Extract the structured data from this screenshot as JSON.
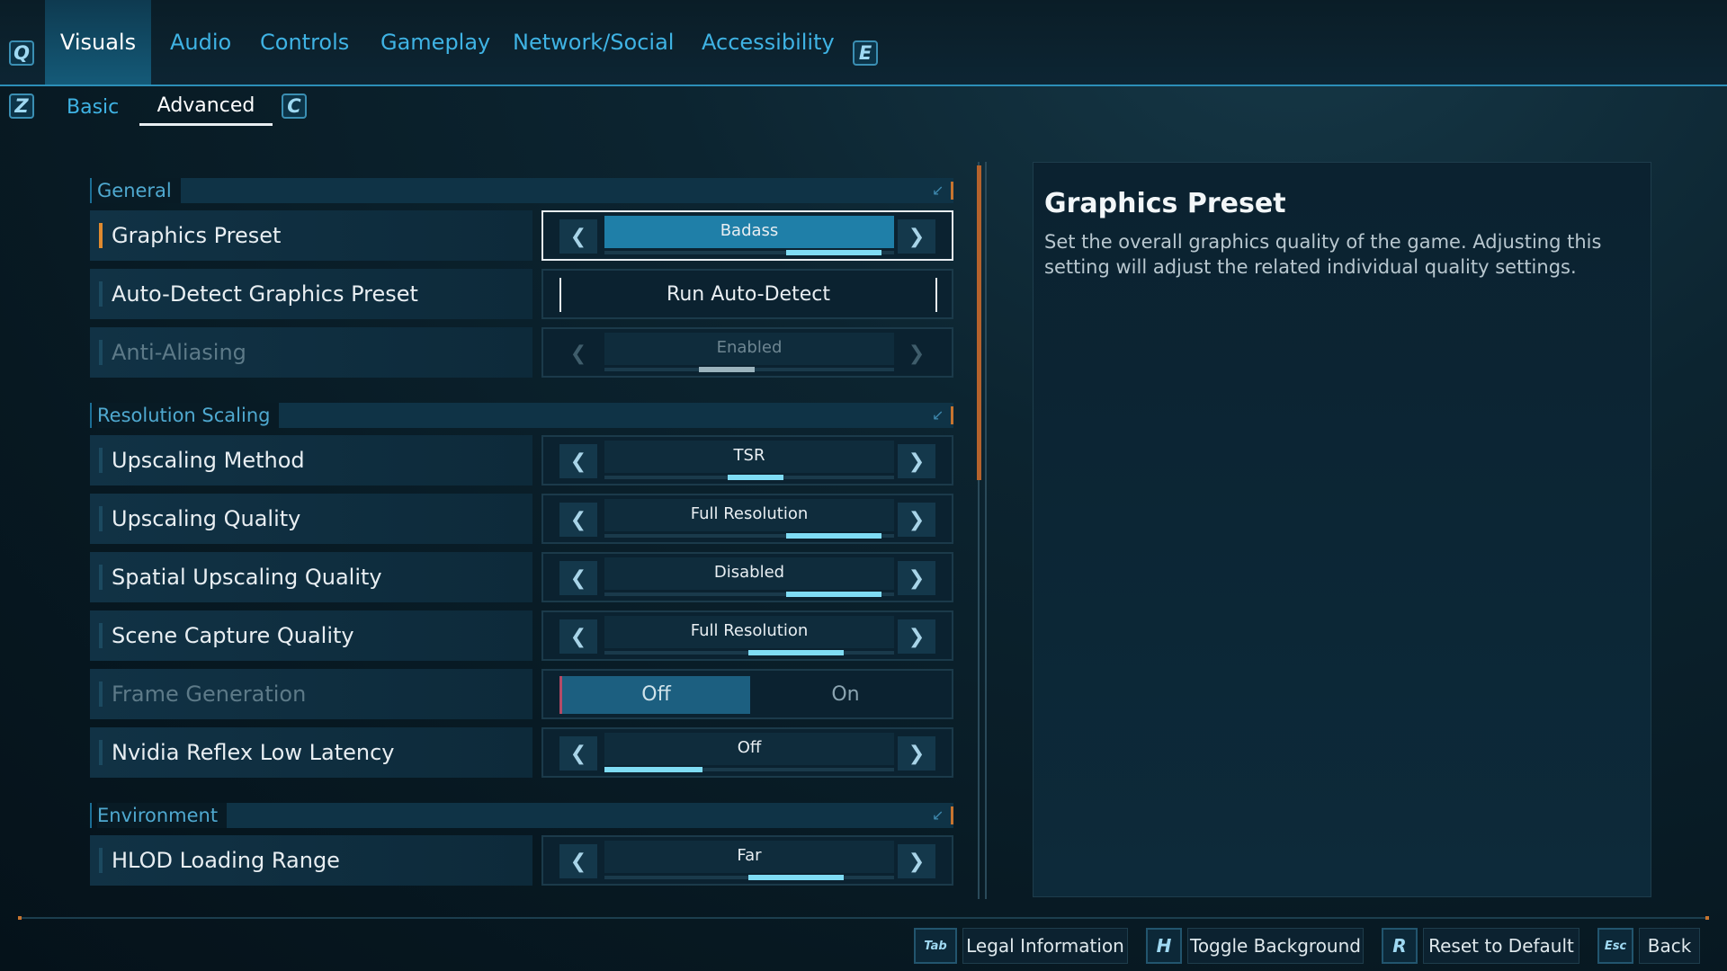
{
  "top_tabs": {
    "left_key": "Q",
    "right_key": "E",
    "items": [
      "Visuals",
      "Audio",
      "Controls",
      "Gameplay",
      "Network/Social",
      "Accessibility"
    ]
  },
  "sub_tabs": {
    "left_key": "Z",
    "right_key": "C",
    "items": [
      "Basic",
      "Advanced"
    ]
  },
  "sections": {
    "general": "General",
    "resolution_scaling": "Resolution Scaling",
    "environment": "Environment"
  },
  "settings": {
    "graphics_preset": {
      "label": "Graphics Preset",
      "value": "Badass",
      "level_fraction": 0.8
    },
    "auto_detect": {
      "label": "Auto-Detect Graphics Preset",
      "value": "Run Auto-Detect"
    },
    "anti_aliasing": {
      "label": "Anti-Aliasing",
      "value": "Enabled",
      "level_fraction": 0.5
    },
    "upscaling_method": {
      "label": "Upscaling Method",
      "value": "TSR",
      "level_fraction": 0.6
    },
    "upscaling_quality": {
      "label": "Upscaling Quality",
      "value": "Full Resolution",
      "level_fraction": 0.8
    },
    "spatial_upscaling_quality": {
      "label": "Spatial Upscaling Quality",
      "value": "Disabled",
      "level_fraction": 0.8
    },
    "scene_capture_quality": {
      "label": "Scene Capture Quality",
      "value": "Full Resolution",
      "level_fraction": 0.67
    },
    "frame_generation": {
      "label": "Frame Generation",
      "options": [
        "Off",
        "On"
      ],
      "selected": "Off"
    },
    "nvidia_reflex": {
      "label": "Nvidia Reflex Low Latency",
      "value": "Off",
      "level_fraction": 0.33
    },
    "hlod_loading_range": {
      "label": "HLOD Loading Range",
      "value": "Far",
      "level_fraction": 0.67
    }
  },
  "description": {
    "title": "Graphics Preset",
    "body": "Set the overall graphics quality of the game. Adjusting this setting will adjust the related individual quality settings."
  },
  "footer": {
    "legal": {
      "key": "Tab",
      "label": "Legal Information"
    },
    "toggle_bg": {
      "key": "H",
      "label": "Toggle Background"
    },
    "reset": {
      "key": "R",
      "label": "Reset to Default"
    },
    "back": {
      "key": "Esc",
      "label": "Back"
    }
  },
  "colors": {
    "accent": "#3fb3e4",
    "selected_marker": "#e08a2f",
    "scroll_thumb": "#b5622c"
  },
  "icons": {
    "arrow_left": "chevron-left-icon",
    "arrow_right": "chevron-right-icon",
    "collapse": "collapse-icon"
  }
}
